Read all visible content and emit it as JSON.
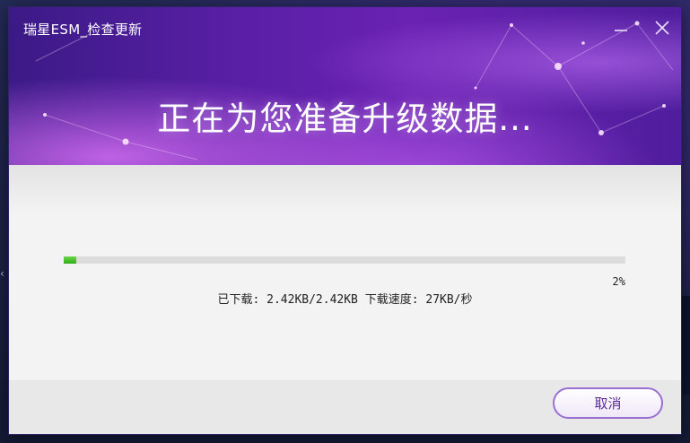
{
  "window": {
    "title": "瑞星ESM_检查更新",
    "minimize_glyph": "—",
    "close_glyph": "✕"
  },
  "header": {
    "headline": "正在为您准备升级数据..."
  },
  "progress": {
    "percent_text": "2%",
    "fraction": 0.022,
    "downloaded_label": "已下载:",
    "downloaded_value": "2.42KB/2.42KB",
    "speed_label": "下载速度:",
    "speed_value": "27KB/秒"
  },
  "footer": {
    "cancel_label": "取消"
  },
  "colors": {
    "header_purple": "#5a1fa6",
    "progress_green": "#2fae18",
    "button_border": "#9a6fd4"
  },
  "icons": {
    "minimize": "minimize-icon",
    "close": "close-icon"
  }
}
